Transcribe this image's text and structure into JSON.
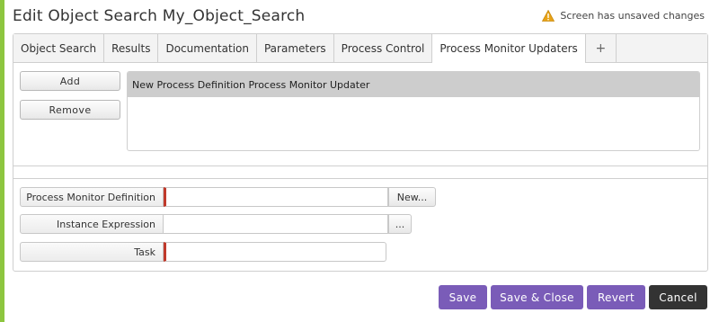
{
  "window": {
    "title": "Edit Object Search My_Object_Search",
    "unsaved_text": "Screen has unsaved changes",
    "warning_icon": "warning-triangle-icon"
  },
  "tabs": [
    {
      "label": "Object Search",
      "active": false
    },
    {
      "label": "Results",
      "active": false
    },
    {
      "label": "Documentation",
      "active": false
    },
    {
      "label": "Parameters",
      "active": false
    },
    {
      "label": "Process Control",
      "active": false
    },
    {
      "label": "Process Monitor Updaters",
      "active": true
    },
    {
      "label": "+",
      "active": false
    }
  ],
  "list_controls": {
    "add_label": "Add",
    "remove_label": "Remove"
  },
  "updaters_list": {
    "items": [
      "New Process Definition Process Monitor Updater"
    ],
    "selected_index": 0
  },
  "fields": {
    "process_monitor_definition": {
      "label": "Process Monitor Definition",
      "value": "",
      "button": "New..."
    },
    "instance_expression": {
      "label": "Instance Expression",
      "value": "",
      "button": "..."
    },
    "task": {
      "label": "Task",
      "value": ""
    }
  },
  "footer": {
    "save_label": "Save",
    "save_close_label": "Save & Close",
    "revert_label": "Revert",
    "cancel_label": "Cancel"
  },
  "colors": {
    "accent_green": "#8dc63f",
    "primary_purple": "#7a5cb8",
    "cancel_dark": "#333333",
    "required_red": "#c0392b",
    "warning_orange": "#e8a317"
  }
}
